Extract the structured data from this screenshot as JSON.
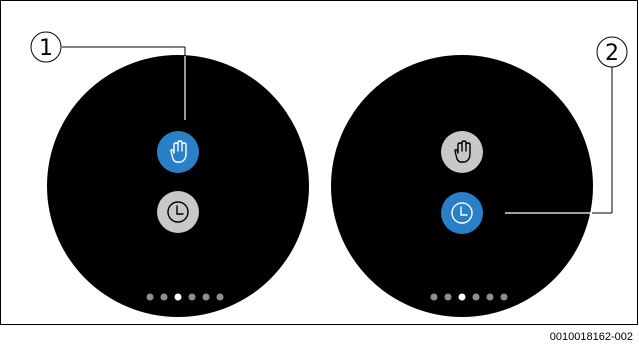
{
  "callouts": [
    {
      "number": "1"
    },
    {
      "number": "2"
    }
  ],
  "screens": [
    {
      "active_mode": "manual",
      "buttons": [
        {
          "icon": "hand-icon",
          "state": "selected"
        },
        {
          "icon": "clock-icon",
          "state": "unselected"
        }
      ],
      "pagination": {
        "count": 6,
        "active_index": 2
      }
    },
    {
      "active_mode": "automatic",
      "buttons": [
        {
          "icon": "hand-icon",
          "state": "unselected"
        },
        {
          "icon": "clock-icon",
          "state": "selected"
        }
      ],
      "pagination": {
        "count": 6,
        "active_index": 2
      }
    }
  ],
  "colors": {
    "screen": "#000000",
    "selected": "#2a7fc9",
    "unselected": "#c8c8c8",
    "dot_active": "#ffffff",
    "dot_inactive": "#8e8e8e"
  },
  "figure_code": "0010018162-002"
}
